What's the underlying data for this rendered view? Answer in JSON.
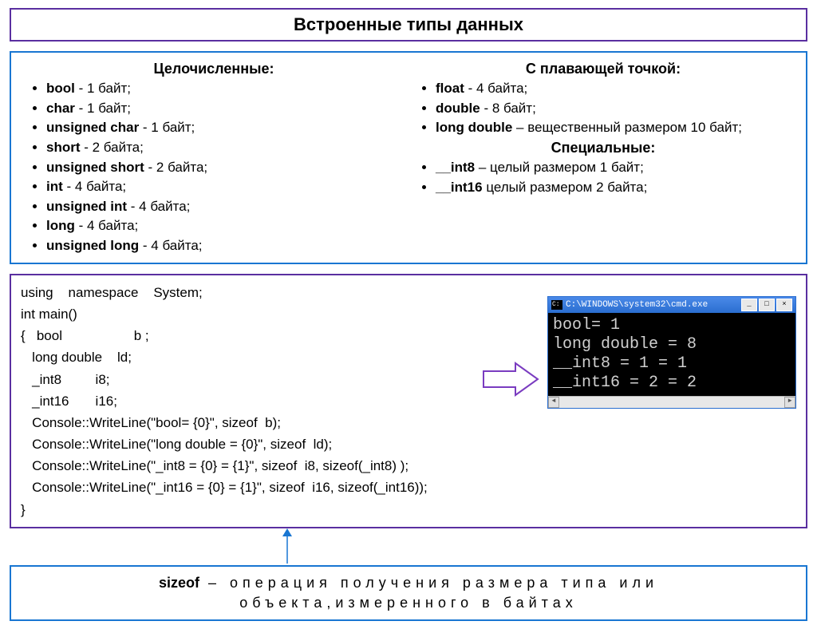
{
  "title": "Встроенные типы данных",
  "integer": {
    "header": "Целочисленные:",
    "items": [
      {
        "name": "bool",
        "desc": " - 1 байт;"
      },
      {
        "name": "char",
        "desc": " - 1 байт;"
      },
      {
        "name": "unsigned  char",
        "desc": "    - 1 байт;"
      },
      {
        "name": "short",
        "desc": " - 2 байта;"
      },
      {
        "name": "unsigned  short",
        "desc": " - 2 байта;"
      },
      {
        "name": "int",
        "desc": "      - 4 байта;"
      },
      {
        "name": "unsigned  int",
        "desc": "      - 4 байта;"
      },
      {
        "name": "long",
        "desc": "    - 4 байта;"
      },
      {
        "name": "unsigned  long",
        "desc": " - 4 байта;"
      }
    ]
  },
  "floating": {
    "header": "С плавающей точкой:",
    "items": [
      {
        "name": "float",
        "desc": "   - 4 байта;"
      },
      {
        "name": "double",
        "desc": " - 8 байт;"
      },
      {
        "name": "long double",
        "desc": " – вещественный размером 10 байт;"
      }
    ]
  },
  "special": {
    "header": "Специальные:",
    "items": [
      {
        "name": "__int8",
        "desc": " – целый размером 1 байт;"
      },
      {
        "name": "__int16",
        "desc": " целый размером 2 байта;"
      }
    ]
  },
  "code": "using    namespace    System;\nint main()\n{   bool                   b ;\n   long double    ld;\n   _int8         i8;\n   _int16       i16;\n   Console::WriteLine(\"bool= {0}\", sizeof  b);\n   Console::WriteLine(\"long double = {0}\", sizeof  ld);\n   Console::WriteLine(\"_int8 = {0} = {1}\", sizeof  i8, sizeof(_int8) );\n   Console::WriteLine(\"_int16 = {0} = {1}\", sizeof  i16, sizeof(_int16));\n}",
  "console": {
    "title": "C:\\WINDOWS\\system32\\cmd.exe",
    "output": "bool= 1\nlong double = 8\n__int8 = 1 = 1\n__int16 = 2 = 2"
  },
  "footer": {
    "keyword": "sizeof",
    "text1": " – операция получения размера типа или",
    "text2": "объекта,измеренного в байтах"
  }
}
